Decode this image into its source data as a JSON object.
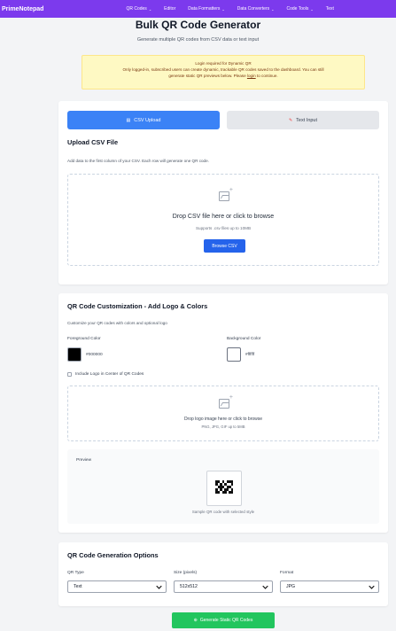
{
  "nav": {
    "brand": "PrimeNotepad",
    "items": [
      {
        "label": "QR Codes",
        "has_dropdown": true
      },
      {
        "label": "Editor",
        "has_dropdown": false
      },
      {
        "label": "Data Formatters",
        "has_dropdown": true
      },
      {
        "label": "Data Converters",
        "has_dropdown": true
      },
      {
        "label": "Code Tools",
        "has_dropdown": true
      },
      {
        "label": "Text",
        "has_dropdown": false
      }
    ],
    "color": "#7c3aed"
  },
  "header": {
    "title": "Bulk QR Code Generator",
    "subtitle": "Generate multiple QR codes from CSV data or text input"
  },
  "notice": {
    "line1": "Login required for Dynamic QR",
    "line2": "Only logged-in, subscribed users can create dynamic, trackable QR codes saved to the dashboard. You can still",
    "line3_before": "generate static QR previews below. Please ",
    "line3_link": "login",
    "line3_after": " to continue."
  },
  "tabs": {
    "csv": {
      "label": "CSV Upload",
      "icon": "file-icon",
      "active": true
    },
    "text": {
      "label": "Text Input",
      "icon": "edit-icon",
      "active": false
    }
  },
  "upload": {
    "title": "Upload CSV File",
    "description": "Add data to the first column of your CSV. Each row will generate one QR code.",
    "drop_text": "Drop CSV file here or click to browse",
    "support_text": "Supports .csv files up to 10MB",
    "browse_label": "Browse CSV"
  },
  "customization": {
    "title": "QR Code Customization - Add Logo & Colors",
    "description": "Customize your QR codes with colors and optional logo",
    "fg_label": "Foreground Color",
    "fg_value": "#000000",
    "bg_label": "Background Color",
    "bg_value": "#ffffff",
    "logo_checkbox_label": "Include Logo in Center of QR Codes",
    "logo_checked": false,
    "logo_drop_text": "Drop logo image here or click to browse",
    "logo_support_text": "PNG, JPG, GIF up to 5MB",
    "preview_label": "Preview",
    "preview_caption": "Sample QR code with selected style"
  },
  "options": {
    "title": "QR Code Generation Options",
    "qr_type_label": "QR Type",
    "qr_type_value": "Text",
    "size_label": "Size (pixels)",
    "size_value": "512x512",
    "format_label": "Format",
    "format_value": "JPG"
  },
  "generate": {
    "label": "Generate Static QR Codes",
    "color": "#22c55e"
  }
}
